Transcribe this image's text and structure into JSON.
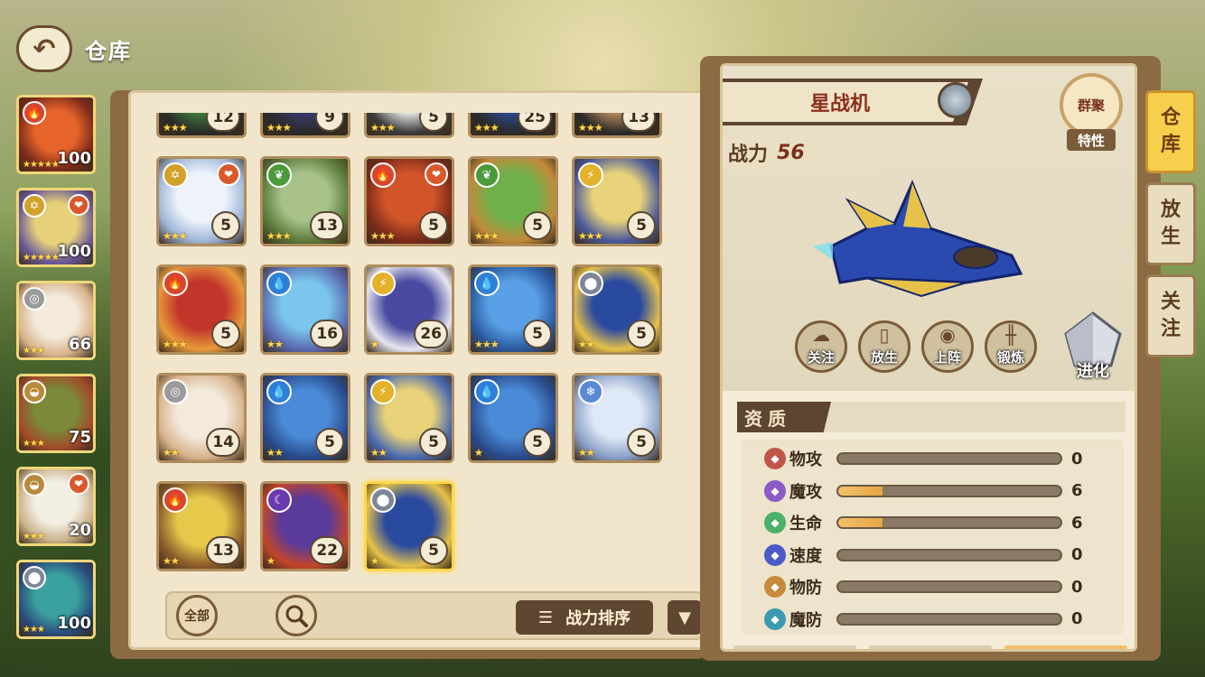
{
  "topbar": {
    "title": "仓库"
  },
  "team": [
    {
      "elem": "fire",
      "elem_color": "#d9462b",
      "heart": false,
      "stars": "★★★★★",
      "level": "100",
      "art": [
        "#e6632b",
        "#7a2b1a"
      ]
    },
    {
      "elem": "star",
      "elem_color": "#d2a12a",
      "heart": true,
      "stars": "★★★★★",
      "level": "100",
      "art": [
        "#e7d07a",
        "#6a5a9a"
      ]
    },
    {
      "elem": "normal",
      "elem_color": "#9a9a9a",
      "heart": false,
      "stars": "★★★",
      "level": "66",
      "art": [
        "#f3eadc",
        "#d8b28a"
      ]
    },
    {
      "elem": "ground",
      "elem_color": "#b98a3c",
      "heart": false,
      "stars": "★★★",
      "level": "75",
      "art": [
        "#7a8a3a",
        "#a24a2a"
      ]
    },
    {
      "elem": "ground",
      "elem_color": "#b98a3c",
      "heart": true,
      "stars": "★★★",
      "level": "20",
      "art": [
        "#f4efe3",
        "#c9b08a"
      ]
    },
    {
      "elem": "metal",
      "elem_color": "#7c8898",
      "heart": false,
      "stars": "★★★",
      "level": "100",
      "art": [
        "#3aa0a0",
        "#2a4a7a"
      ]
    }
  ],
  "pets": [
    {
      "elem": "",
      "heart": false,
      "stars": "★★★",
      "level": "12",
      "art": [
        "#3e7a3a",
        "#2a2a2a"
      ]
    },
    {
      "elem": "",
      "heart": false,
      "stars": "★★★",
      "level": "9",
      "art": [
        "#3a3a6a",
        "#2a2a2a"
      ]
    },
    {
      "elem": "",
      "heart": false,
      "stars": "★★★",
      "level": "5",
      "art": [
        "#e6e6e6",
        "#3a3a3a"
      ]
    },
    {
      "elem": "",
      "heart": false,
      "stars": "★★★",
      "level": "25",
      "art": [
        "#2a4a8a",
        "#2a2a2a"
      ]
    },
    {
      "elem": "",
      "heart": false,
      "stars": "★★★",
      "level": "13",
      "art": [
        "#b58a5a",
        "#2a2a2a"
      ]
    },
    {
      "elem": "star",
      "elem_color": "#d2a12a",
      "heart": true,
      "stars": "★★★",
      "level": "5",
      "art": [
        "#eef3fb",
        "#9fb6d8"
      ]
    },
    {
      "elem": "grass",
      "elem_color": "#4c9a3a",
      "heart": false,
      "stars": "★★★",
      "level": "13",
      "art": [
        "#a8c28a",
        "#5a7a3a"
      ]
    },
    {
      "elem": "fire",
      "elem_color": "#d9462b",
      "heart": true,
      "stars": "★★★",
      "level": "5",
      "art": [
        "#d2552a",
        "#7a2a1a"
      ]
    },
    {
      "elem": "grass",
      "elem_color": "#4c9a3a",
      "heart": false,
      "stars": "★★★",
      "level": "5",
      "art": [
        "#6fb04a",
        "#c28a3a"
      ]
    },
    {
      "elem": "thunder",
      "elem_color": "#e3b12a",
      "heart": false,
      "stars": "★★★",
      "level": "5",
      "art": [
        "#e8d27a",
        "#4a5a9a"
      ]
    },
    {
      "elem": "fire",
      "elem_color": "#d9462b",
      "heart": false,
      "stars": "★★★",
      "level": "5",
      "art": [
        "#c2352a",
        "#e89a3a"
      ]
    },
    {
      "elem": "water",
      "elem_color": "#2f7fd6",
      "heart": false,
      "stars": "★★",
      "level": "16",
      "art": [
        "#7ac6ee",
        "#5a6ab0"
      ]
    },
    {
      "elem": "thunder",
      "elem_color": "#e3b12a",
      "heart": false,
      "stars": "★",
      "level": "26",
      "art": [
        "#4a4aa0",
        "#e6e6f0"
      ]
    },
    {
      "elem": "water",
      "elem_color": "#2f7fd6",
      "heart": false,
      "stars": "★★★",
      "level": "5",
      "art": [
        "#5aa0e6",
        "#2a5aa0"
      ]
    },
    {
      "elem": "metal",
      "elem_color": "#7c8898",
      "heart": false,
      "stars": "★★",
      "level": "5",
      "art": [
        "#2a4aa0",
        "#e6c24a"
      ]
    },
    {
      "elem": "normal",
      "elem_color": "#9a9a9a",
      "heart": false,
      "stars": "★★",
      "level": "14",
      "art": [
        "#f3eadc",
        "#d8b28a"
      ]
    },
    {
      "elem": "water",
      "elem_color": "#2f7fd6",
      "heart": false,
      "stars": "★★",
      "level": "5",
      "art": [
        "#4a8ad6",
        "#2a4a8a"
      ]
    },
    {
      "elem": "thunder",
      "elem_color": "#e3b12a",
      "heart": false,
      "stars": "★★",
      "level": "5",
      "art": [
        "#e8d27a",
        "#4a6ab0"
      ]
    },
    {
      "elem": "water",
      "elem_color": "#2f7fd6",
      "heart": false,
      "stars": "★",
      "level": "5",
      "art": [
        "#4a8ad6",
        "#2a4a8a"
      ]
    },
    {
      "elem": "ice",
      "elem_color": "#5a8ad6",
      "heart": false,
      "stars": "★★",
      "level": "5",
      "art": [
        "#dfe8f6",
        "#8aa0c8"
      ]
    },
    {
      "elem": "fire",
      "elem_color": "#d9462b",
      "heart": false,
      "stars": "★★",
      "level": "13",
      "art": [
        "#e6c84a",
        "#8a5a2a"
      ]
    },
    {
      "elem": "dark",
      "elem_color": "#6a3ab0",
      "heart": false,
      "stars": "★",
      "level": "22",
      "art": [
        "#5a3a9a",
        "#c2452a"
      ]
    },
    {
      "elem": "metal",
      "elem_color": "#7c8898",
      "heart": false,
      "stars": "★",
      "level": "5",
      "art": [
        "#2a4aa0",
        "#e6c24a"
      ],
      "selected": true
    }
  ],
  "toolbar": {
    "all_label": "全部",
    "sort_label": "战力排序"
  },
  "detail": {
    "name": "星战机",
    "power_label": "战力",
    "power_value": "56",
    "trait_badge": "群聚",
    "trait_label": "特性",
    "actions": [
      {
        "label": "关注",
        "icon": "cloud-icon"
      },
      {
        "label": "放生",
        "icon": "door-icon"
      },
      {
        "label": "上阵",
        "icon": "ball-icon"
      },
      {
        "label": "锻炼",
        "icon": "dumbbell-icon"
      }
    ],
    "evolve_label": "进化",
    "quality_label": "资质",
    "stats": [
      {
        "label": "物攻",
        "value": "0",
        "ratio": 0,
        "color": "#c0564a"
      },
      {
        "label": "魔攻",
        "value": "6",
        "ratio": 0.2,
        "color": "#8a5ac6"
      },
      {
        "label": "生命",
        "value": "6",
        "ratio": 0.2,
        "color": "#4ab06a"
      },
      {
        "label": "速度",
        "value": "0",
        "ratio": 0,
        "color": "#4a5ac6"
      },
      {
        "label": "物防",
        "value": "0",
        "ratio": 0,
        "color": "#c68a3a"
      },
      {
        "label": "魔防",
        "value": "0",
        "ratio": 0,
        "color": "#3a9ab0"
      }
    ]
  },
  "side_tabs": [
    {
      "label": [
        "仓",
        "库"
      ],
      "active": true
    },
    {
      "label": [
        "放",
        "生"
      ],
      "active": false
    },
    {
      "label": [
        "关",
        "注"
      ],
      "active": false
    }
  ]
}
